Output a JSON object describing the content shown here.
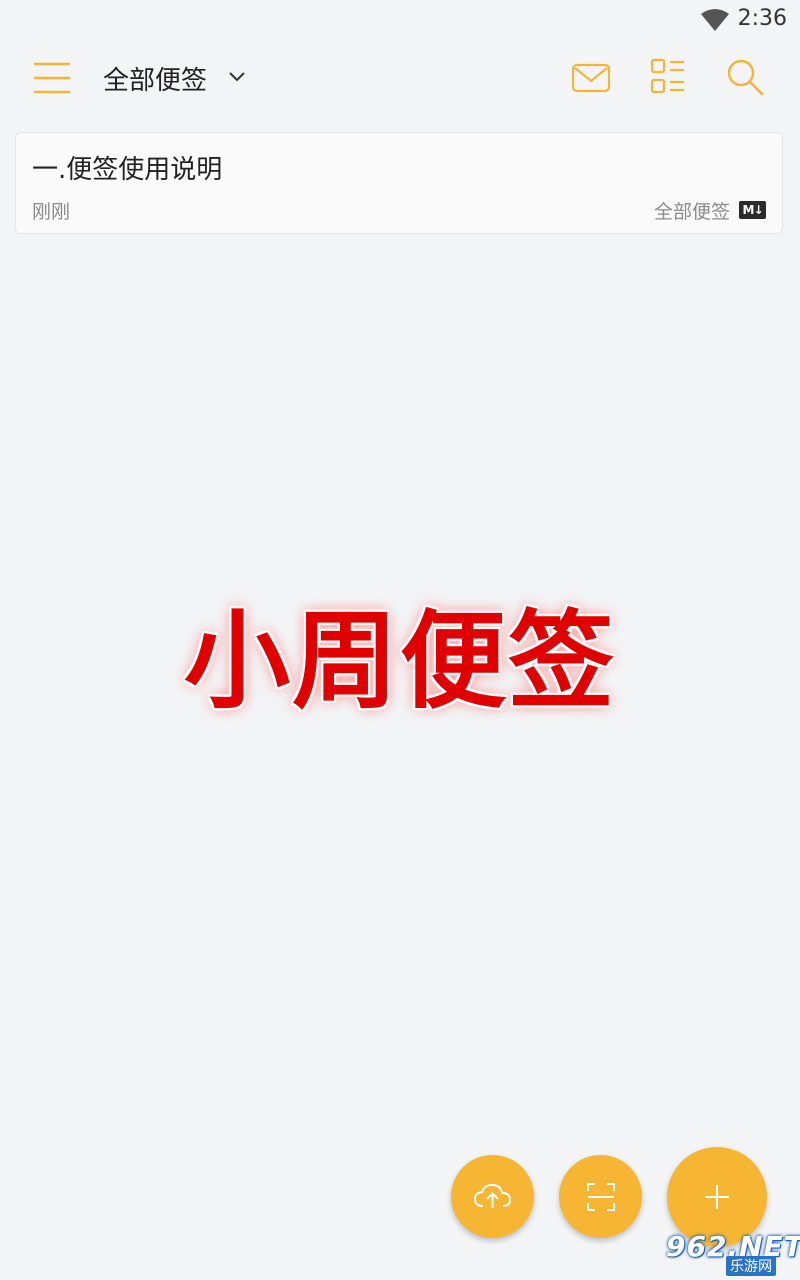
{
  "status_bar": {
    "time": "2:36",
    "wifi_icon": "wifi-icon"
  },
  "toolbar": {
    "menu_icon": "menu-icon",
    "folder_title": "全部便签",
    "dropdown_icon": "chevron-down-icon",
    "mail_icon": "mail-icon",
    "layout_icon": "layout-icon",
    "search_icon": "search-icon",
    "accent_color": "#f6b532"
  },
  "notes": [
    {
      "title": "一.便签使用说明",
      "time": "刚刚",
      "folder": "全部便签",
      "badge": "M↓"
    }
  ],
  "watermark": {
    "text": "小周便签",
    "color": "#e00000"
  },
  "fabs": {
    "upload_icon": "cloud-upload-icon",
    "scan_icon": "scan-icon",
    "add_icon": "plus-icon",
    "color": "#f6b532"
  },
  "site_logo": {
    "main": "962.NET",
    "sub": "乐游网"
  }
}
